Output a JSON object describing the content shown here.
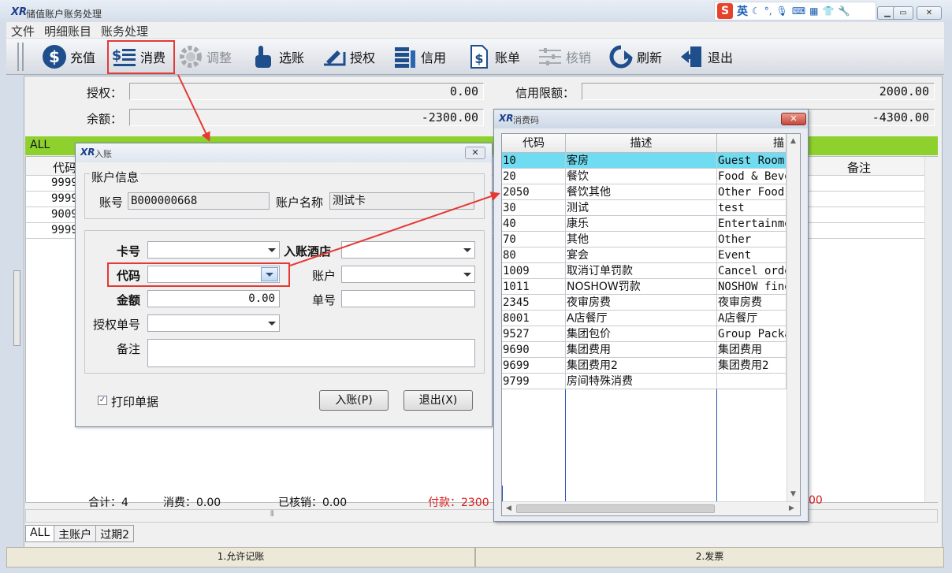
{
  "app": {
    "title": "储值账户账务处理"
  },
  "menu": [
    "文件",
    "明细账目",
    "账务处理"
  ],
  "toolbar": [
    {
      "label": "充值",
      "icon": "dollar-icon",
      "enabled": true
    },
    {
      "label": "消费",
      "icon": "list-dollar-icon",
      "enabled": true
    },
    {
      "label": "调整",
      "icon": "gear-icon",
      "enabled": false
    },
    {
      "label": "选账",
      "icon": "hand-pointer-icon",
      "enabled": true
    },
    {
      "label": "授权",
      "icon": "authorize-icon",
      "enabled": true
    },
    {
      "label": "信用",
      "icon": "coins-icon",
      "enabled": true
    },
    {
      "label": "账单",
      "icon": "bill-icon",
      "enabled": true
    },
    {
      "label": "核销",
      "icon": "writeoff-icon",
      "enabled": false
    },
    {
      "label": "刷新",
      "icon": "refresh-icon",
      "enabled": true
    },
    {
      "label": "退出",
      "icon": "exit-icon",
      "enabled": true
    }
  ],
  "summary": {
    "auth_label": "授权：",
    "auth_value": "0.00",
    "balance_label": "余额：",
    "balance_value": "-2300.00",
    "credit_label": "信用限额：",
    "credit_value": "2000.00",
    "right_value": "-4300.00"
  },
  "grid": {
    "tab_label": "ALL",
    "code_header": "代码",
    "note_header": "备注",
    "codes": [
      "9999",
      "9999",
      "9009",
      "9999"
    ]
  },
  "footer": {
    "total": "合计：4",
    "consume": "消费：0.00",
    "written_off": "已核销：0.00",
    "payment": "付款：2300",
    "payment_tail": "00"
  },
  "bottom_tabs": [
    "ALL",
    "主账户",
    "过期2"
  ],
  "statusbar": [
    "1.允许记账",
    "2.发票"
  ],
  "entry_dialog": {
    "title": "入账",
    "account_group": "账户信息",
    "account_no_label": "账号",
    "account_no": "B000000668",
    "account_name_label": "账户名称",
    "account_name": "测试卡",
    "card_label": "卡号",
    "hotel_label": "入账酒店",
    "code_label": "代码",
    "account_label": "账户",
    "amount_label": "金额",
    "amount_value": "0.00",
    "bill_no_label": "单号",
    "auth_no_label": "授权单号",
    "note_label": "备注",
    "print_label": "打印单据",
    "print_checked": true,
    "post_button": "入账(P)",
    "exit_button": "退出(X)"
  },
  "code_dialog": {
    "title": "消费码",
    "headers": [
      "代码",
      "描述",
      "描"
    ],
    "rows": [
      {
        "code": "10",
        "desc": "客房",
        "en": "Guest Room"
      },
      {
        "code": "20",
        "desc": "餐饮",
        "en": "Food & Beve"
      },
      {
        "code": "2050",
        "desc": "餐饮其他",
        "en": "Other Food"
      },
      {
        "code": "30",
        "desc": "测试",
        "en": "test"
      },
      {
        "code": "40",
        "desc": "康乐",
        "en": "Entertainme"
      },
      {
        "code": "70",
        "desc": "其他",
        "en": "Other"
      },
      {
        "code": "80",
        "desc": "宴会",
        "en": "Event"
      },
      {
        "code": "1009",
        "desc": "取消订单罚款",
        "en": "Cancel orde"
      },
      {
        "code": "1011",
        "desc": "NOSHOW罚款",
        "en": "NOSHOW fine"
      },
      {
        "code": "2345",
        "desc": "夜审房费",
        "en": "夜审房费"
      },
      {
        "code": "8001",
        "desc": "A店餐厅",
        "en": "A店餐厅"
      },
      {
        "code": "9527",
        "desc": "集团包价",
        "en": "Group Packa"
      },
      {
        "code": "9690",
        "desc": "集团费用",
        "en": "集团费用"
      },
      {
        "code": "9699",
        "desc": "集团费用2",
        "en": "集团费用2"
      },
      {
        "code": "9799",
        "desc": "房间特殊消费",
        "en": ""
      }
    ],
    "selected_index": 0
  },
  "ime": {
    "logo": "S",
    "mode": "英"
  },
  "colors": {
    "highlight_box": "#e53935",
    "selected_row": "#70dcf2",
    "all_strip": "#8ed12f",
    "payment_text": "#d81b1b"
  }
}
